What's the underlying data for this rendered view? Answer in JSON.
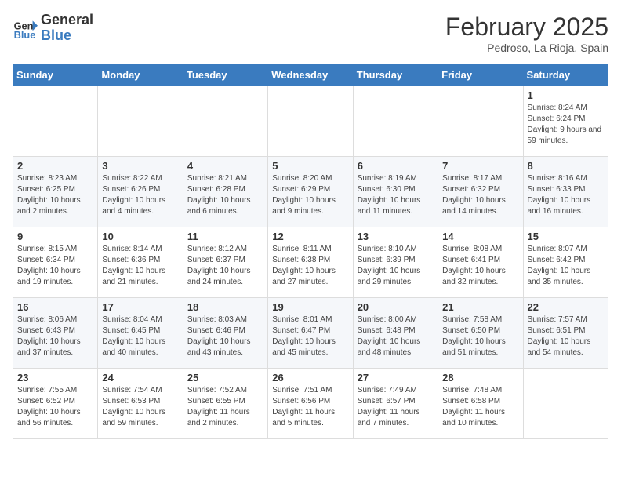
{
  "header": {
    "logo_line1": "General",
    "logo_line2": "Blue",
    "title": "February 2025",
    "subtitle": "Pedroso, La Rioja, Spain"
  },
  "days_of_week": [
    "Sunday",
    "Monday",
    "Tuesday",
    "Wednesday",
    "Thursday",
    "Friday",
    "Saturday"
  ],
  "weeks": [
    [
      {
        "day": "",
        "info": ""
      },
      {
        "day": "",
        "info": ""
      },
      {
        "day": "",
        "info": ""
      },
      {
        "day": "",
        "info": ""
      },
      {
        "day": "",
        "info": ""
      },
      {
        "day": "",
        "info": ""
      },
      {
        "day": "1",
        "info": "Sunrise: 8:24 AM\nSunset: 6:24 PM\nDaylight: 9 hours and 59 minutes."
      }
    ],
    [
      {
        "day": "2",
        "info": "Sunrise: 8:23 AM\nSunset: 6:25 PM\nDaylight: 10 hours and 2 minutes."
      },
      {
        "day": "3",
        "info": "Sunrise: 8:22 AM\nSunset: 6:26 PM\nDaylight: 10 hours and 4 minutes."
      },
      {
        "day": "4",
        "info": "Sunrise: 8:21 AM\nSunset: 6:28 PM\nDaylight: 10 hours and 6 minutes."
      },
      {
        "day": "5",
        "info": "Sunrise: 8:20 AM\nSunset: 6:29 PM\nDaylight: 10 hours and 9 minutes."
      },
      {
        "day": "6",
        "info": "Sunrise: 8:19 AM\nSunset: 6:30 PM\nDaylight: 10 hours and 11 minutes."
      },
      {
        "day": "7",
        "info": "Sunrise: 8:17 AM\nSunset: 6:32 PM\nDaylight: 10 hours and 14 minutes."
      },
      {
        "day": "8",
        "info": "Sunrise: 8:16 AM\nSunset: 6:33 PM\nDaylight: 10 hours and 16 minutes."
      }
    ],
    [
      {
        "day": "9",
        "info": "Sunrise: 8:15 AM\nSunset: 6:34 PM\nDaylight: 10 hours and 19 minutes."
      },
      {
        "day": "10",
        "info": "Sunrise: 8:14 AM\nSunset: 6:36 PM\nDaylight: 10 hours and 21 minutes."
      },
      {
        "day": "11",
        "info": "Sunrise: 8:12 AM\nSunset: 6:37 PM\nDaylight: 10 hours and 24 minutes."
      },
      {
        "day": "12",
        "info": "Sunrise: 8:11 AM\nSunset: 6:38 PM\nDaylight: 10 hours and 27 minutes."
      },
      {
        "day": "13",
        "info": "Sunrise: 8:10 AM\nSunset: 6:39 PM\nDaylight: 10 hours and 29 minutes."
      },
      {
        "day": "14",
        "info": "Sunrise: 8:08 AM\nSunset: 6:41 PM\nDaylight: 10 hours and 32 minutes."
      },
      {
        "day": "15",
        "info": "Sunrise: 8:07 AM\nSunset: 6:42 PM\nDaylight: 10 hours and 35 minutes."
      }
    ],
    [
      {
        "day": "16",
        "info": "Sunrise: 8:06 AM\nSunset: 6:43 PM\nDaylight: 10 hours and 37 minutes."
      },
      {
        "day": "17",
        "info": "Sunrise: 8:04 AM\nSunset: 6:45 PM\nDaylight: 10 hours and 40 minutes."
      },
      {
        "day": "18",
        "info": "Sunrise: 8:03 AM\nSunset: 6:46 PM\nDaylight: 10 hours and 43 minutes."
      },
      {
        "day": "19",
        "info": "Sunrise: 8:01 AM\nSunset: 6:47 PM\nDaylight: 10 hours and 45 minutes."
      },
      {
        "day": "20",
        "info": "Sunrise: 8:00 AM\nSunset: 6:48 PM\nDaylight: 10 hours and 48 minutes."
      },
      {
        "day": "21",
        "info": "Sunrise: 7:58 AM\nSunset: 6:50 PM\nDaylight: 10 hours and 51 minutes."
      },
      {
        "day": "22",
        "info": "Sunrise: 7:57 AM\nSunset: 6:51 PM\nDaylight: 10 hours and 54 minutes."
      }
    ],
    [
      {
        "day": "23",
        "info": "Sunrise: 7:55 AM\nSunset: 6:52 PM\nDaylight: 10 hours and 56 minutes."
      },
      {
        "day": "24",
        "info": "Sunrise: 7:54 AM\nSunset: 6:53 PM\nDaylight: 10 hours and 59 minutes."
      },
      {
        "day": "25",
        "info": "Sunrise: 7:52 AM\nSunset: 6:55 PM\nDaylight: 11 hours and 2 minutes."
      },
      {
        "day": "26",
        "info": "Sunrise: 7:51 AM\nSunset: 6:56 PM\nDaylight: 11 hours and 5 minutes."
      },
      {
        "day": "27",
        "info": "Sunrise: 7:49 AM\nSunset: 6:57 PM\nDaylight: 11 hours and 7 minutes."
      },
      {
        "day": "28",
        "info": "Sunrise: 7:48 AM\nSunset: 6:58 PM\nDaylight: 11 hours and 10 minutes."
      },
      {
        "day": "",
        "info": ""
      }
    ]
  ]
}
